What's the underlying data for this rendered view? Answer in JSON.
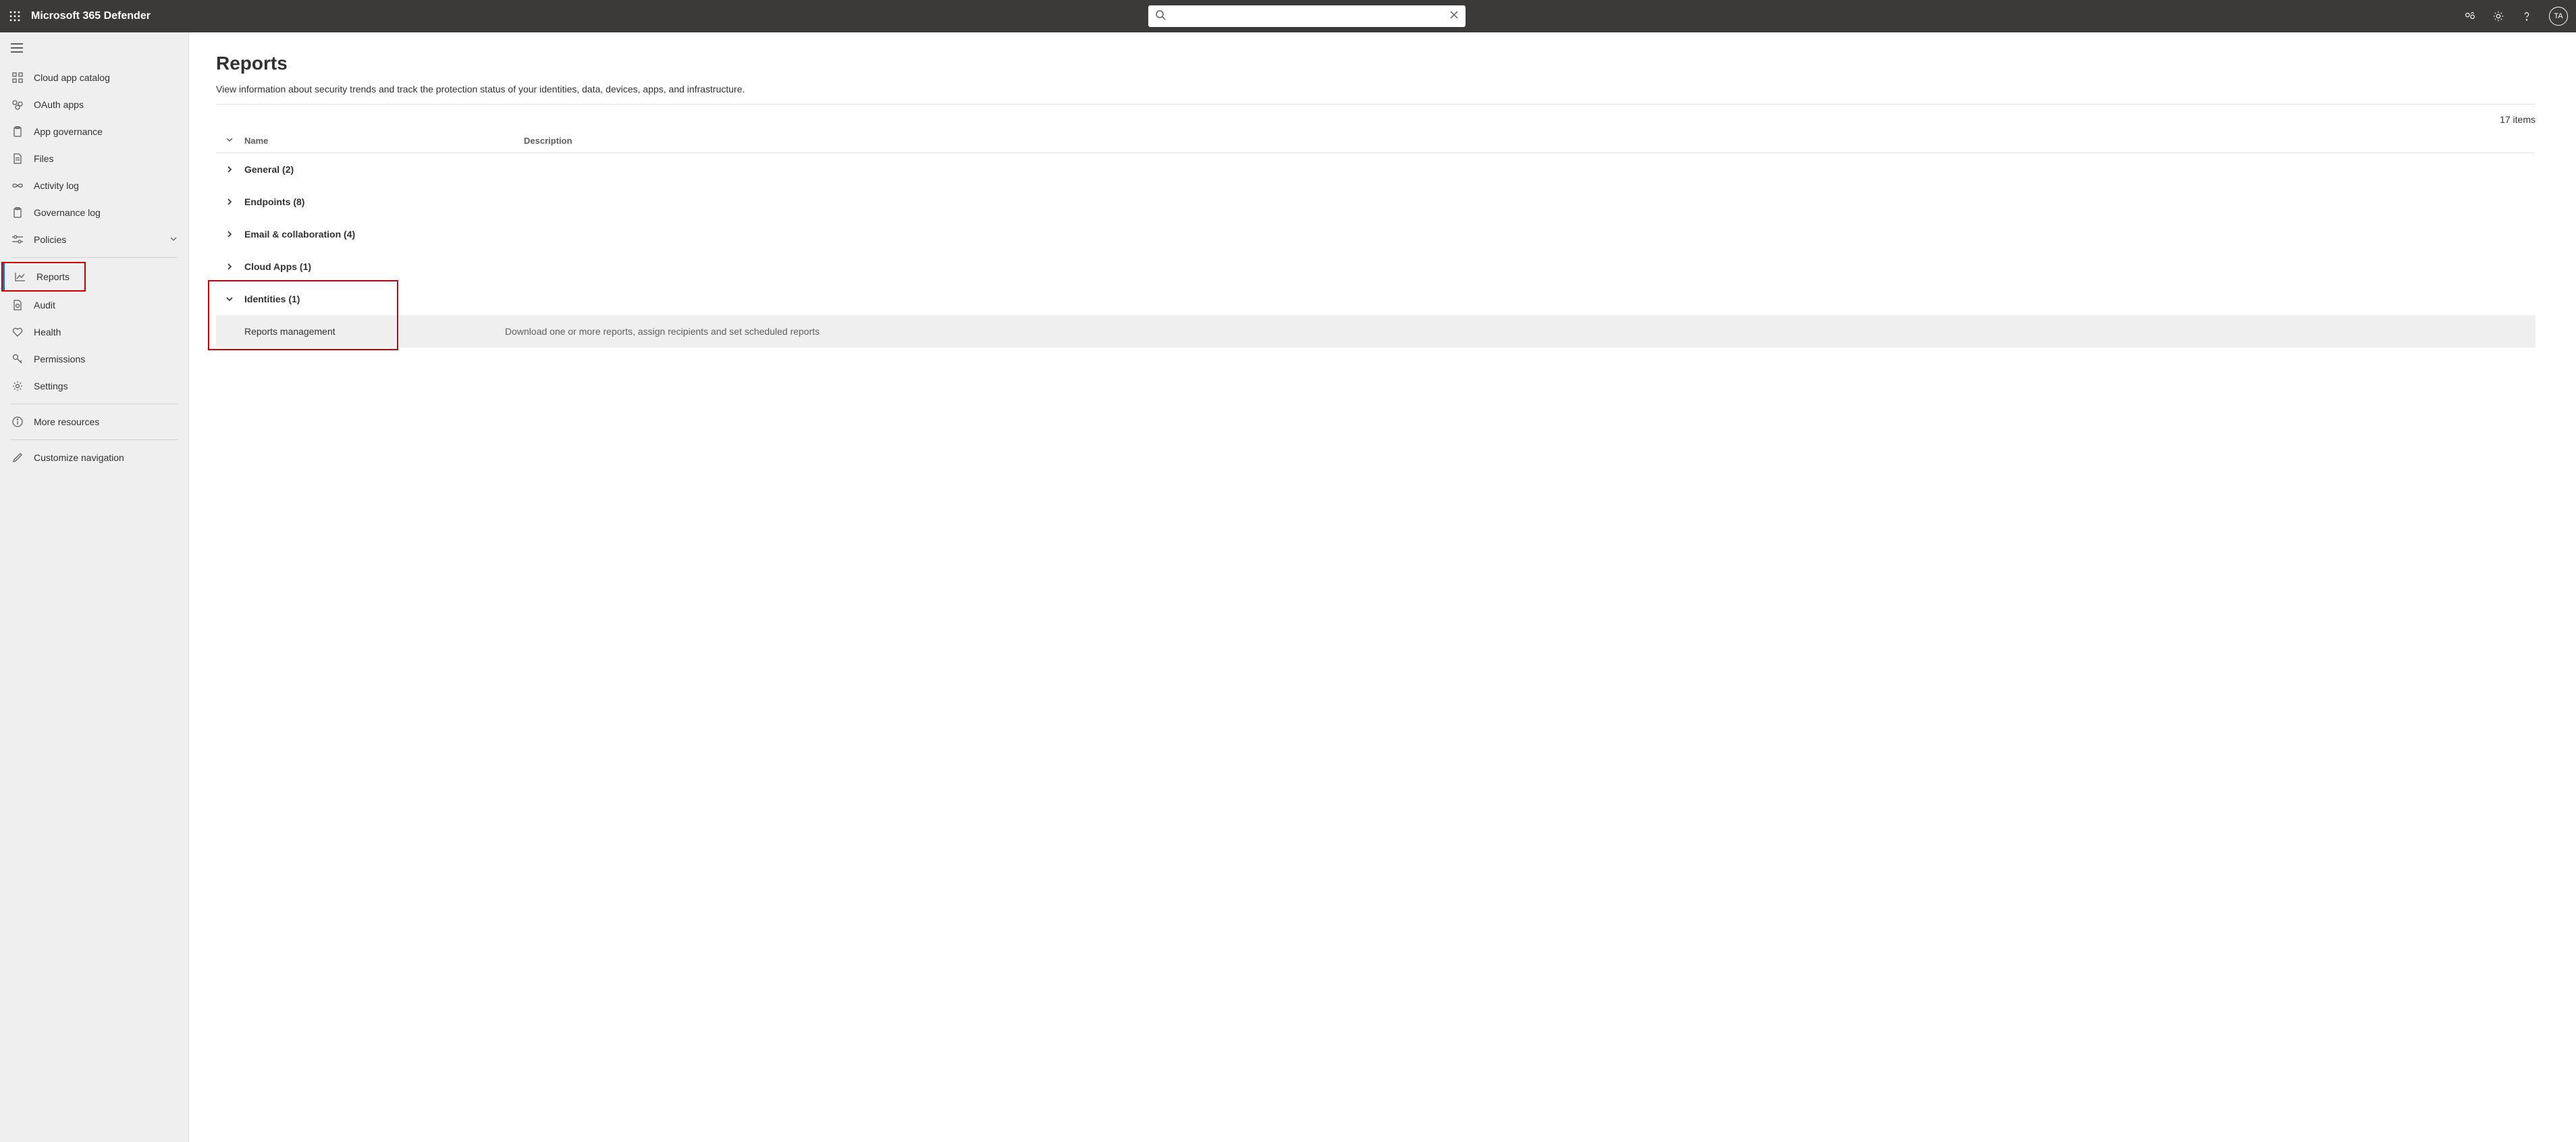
{
  "header": {
    "app_title": "Microsoft 365 Defender",
    "search_placeholder": "",
    "avatar_initials": "TA"
  },
  "sidebar": {
    "items": [
      {
        "label": "Cloud app catalog",
        "icon": "grid-icon"
      },
      {
        "label": "OAuth apps",
        "icon": "users-icon"
      },
      {
        "label": "App governance",
        "icon": "clipboard-icon"
      },
      {
        "label": "Files",
        "icon": "file-icon"
      },
      {
        "label": "Activity log",
        "icon": "infinity-icon"
      },
      {
        "label": "Governance log",
        "icon": "clipboard-icon"
      },
      {
        "label": "Policies",
        "icon": "sliders-icon",
        "has_chevron": true
      }
    ],
    "reports_label": "Reports",
    "audit_label": "Audit",
    "health_label": "Health",
    "permissions_label": "Permissions",
    "settings_label": "Settings",
    "more_resources_label": "More resources",
    "customize_label": "Customize navigation"
  },
  "page": {
    "title": "Reports",
    "subtitle": "View information about security trends and track the protection status of your identities, data, devices, apps, and infrastructure.",
    "items_count_text": "17 items",
    "columns": {
      "name": "Name",
      "description": "Description"
    },
    "groups": [
      {
        "label": "General (2)"
      },
      {
        "label": "Endpoints (8)"
      },
      {
        "label": "Email & collaboration (4)"
      },
      {
        "label": "Cloud Apps (1)"
      }
    ],
    "identities": {
      "label": "Identities (1)",
      "child": {
        "name": "Reports management",
        "description": "Download one or more reports, assign recipients and set scheduled reports"
      }
    }
  }
}
